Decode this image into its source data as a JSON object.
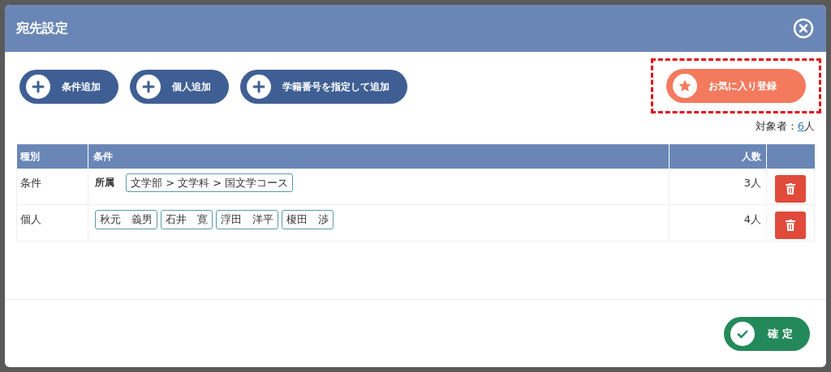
{
  "dialog": {
    "title": "宛先設定"
  },
  "add_buttons": [
    "条件追加",
    "個人追加",
    "学籍番号を指定して追加"
  ],
  "favorite_button": {
    "label": "お気に入り登録",
    "highlighted": true
  },
  "target_count": {
    "label": "対象者：",
    "value": "6",
    "unit": "人"
  },
  "table": {
    "columns": [
      "種別",
      "条件",
      "人数"
    ],
    "rows": [
      {
        "kind": "condition",
        "type": "条件",
        "label": "所属",
        "tags": [
          "文学部 > 文学科 > 国文学コース"
        ],
        "count": "3人"
      },
      {
        "kind": "person",
        "type": "個人",
        "tags": [
          "秋元　義男",
          "石井　寛",
          "浮田　洋平",
          "榎田　渉"
        ],
        "count": "4人"
      }
    ]
  },
  "confirm_button": "確 定"
}
